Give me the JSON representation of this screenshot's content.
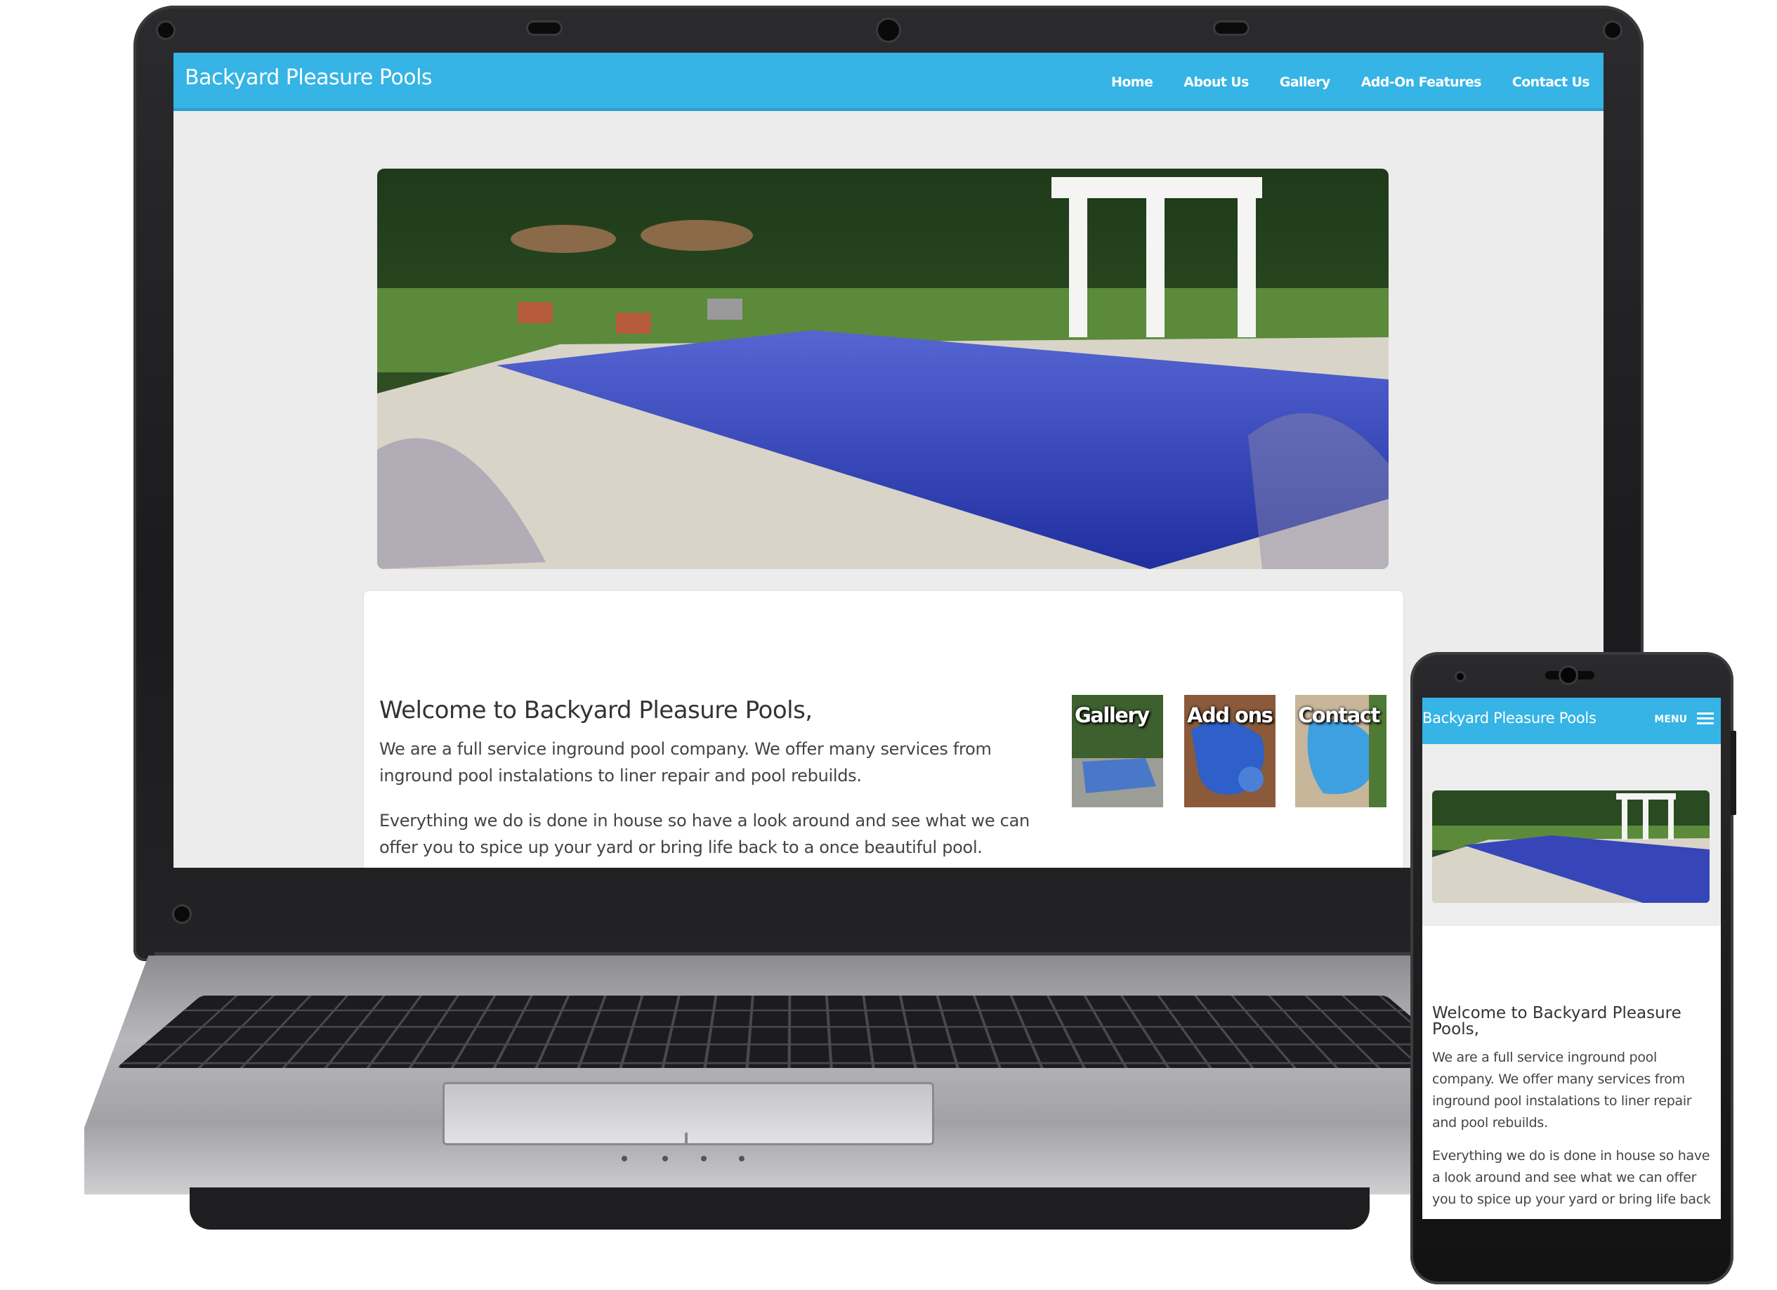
{
  "site": {
    "brand": "Backyard Pleasure Pools",
    "nav": [
      "Home",
      "About Us",
      "Gallery",
      "Add-On Features",
      "Contact Us"
    ],
    "welcome_title": "Welcome to Backyard Pleasure Pools,",
    "paragraph_1": "We are a full service inground pool company. We offer many services from inground pool instalations to liner repair and pool rebuilds.",
    "paragraph_2": "Everything we do is done in house so have a look around and see what we can offer you to spice up your yard or bring life back to a once beautiful pool.",
    "thumbnails": [
      "Gallery",
      "Add ons",
      "Contact"
    ]
  },
  "mobile": {
    "brand": "Backyard Pleasure Pools",
    "menu_label": "MENU",
    "welcome_title": "Welcome to Backyard Pleasure Pools,",
    "paragraph_1": "We are a full service inground pool company. We offer many services from inground pool instalations to liner repair and pool rebuilds.",
    "paragraph_2": "Everything we do is done in house so have a look around and see what we can offer you to spice up your yard or bring life back"
  },
  "colors": {
    "header_blue": "#35b4e5",
    "page_background": "#ececec",
    "pool_water": "#2f47b8"
  },
  "icons": [
    "menu-icon"
  ]
}
